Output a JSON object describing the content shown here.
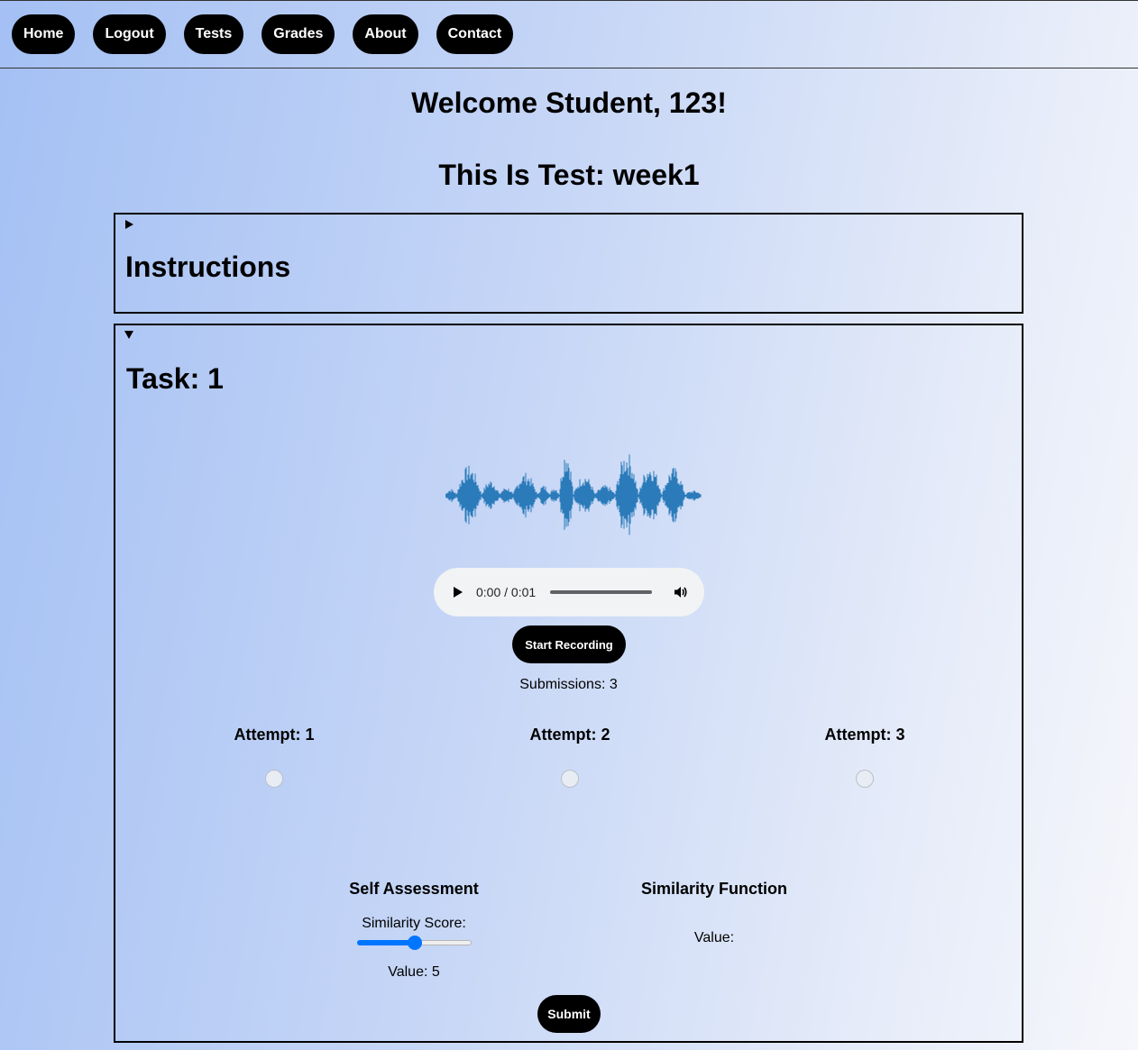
{
  "nav": {
    "items": [
      {
        "label": "Home"
      },
      {
        "label": "Logout"
      },
      {
        "label": "Tests"
      },
      {
        "label": "Grades"
      },
      {
        "label": "About"
      },
      {
        "label": "Contact"
      }
    ]
  },
  "header": {
    "welcome": "Welcome Student, 123!",
    "test_title": "This Is Test: week1"
  },
  "instructions": {
    "title": "Instructions",
    "icon": "triangle-right-icon"
  },
  "task": {
    "title": "Task: 1",
    "icon": "triangle-down-icon",
    "audio": {
      "time": "0:00 / 0:01",
      "play_icon": "play-icon",
      "volume_icon": "volume-icon",
      "waveform_color": "#2b7bba"
    },
    "record_label": "Start Recording",
    "submissions": "Submissions: 3",
    "attempts": [
      {
        "label": "Attempt: 1"
      },
      {
        "label": "Attempt: 2"
      },
      {
        "label": "Attempt: 3"
      }
    ],
    "self_assessment": {
      "title": "Self Assessment",
      "score_label": "Similarity Score:",
      "slider_value": 5,
      "slider_min": 0,
      "slider_max": 10,
      "value_text": "Value: 5"
    },
    "similarity_function": {
      "title": "Similarity Function",
      "value_text": "Value:"
    },
    "submit_label": "Submit"
  },
  "colors": {
    "accent": "#0075ff",
    "button_bg": "#000000"
  }
}
